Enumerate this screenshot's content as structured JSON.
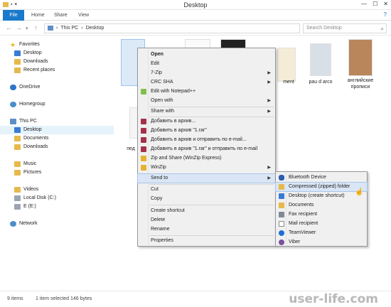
{
  "window": {
    "title": "Desktop",
    "minimize": "—",
    "maximize": "☐",
    "close": "✕"
  },
  "ribbon": {
    "tabs": [
      "File",
      "Home",
      "Share",
      "View"
    ],
    "help": "?"
  },
  "address": {
    "root": "This PC",
    "sep": "›",
    "current": "Desktop",
    "search_placeholder": "Search Desktop"
  },
  "nav": {
    "favorites": "Favorites",
    "fav_items": [
      "Desktop",
      "Downloads",
      "Recent places"
    ],
    "onedrive": "OneDrive",
    "homegroup": "Homegroup",
    "thispc": "This PC",
    "pc_items": [
      "Desktop",
      "Documents",
      "Downloads",
      "Music",
      "Pictures",
      "Videos",
      "Local Disk (C:)",
      "E (E:)"
    ],
    "network": "Network"
  },
  "files": {
    "label_ment": "ment",
    "label_pau": "pau d arco",
    "label_eng_1": "английские",
    "label_eng_2": "прописи",
    "label_ped": "пед"
  },
  "context_menu": {
    "items": [
      "Open",
      "Edit",
      "7-Zip",
      "CRC SHA",
      "Edit with Notepad++",
      "Open with",
      "Share with",
      "Добавить в архив...",
      "Добавить в архив \"1.rar\"",
      "Добавить в архив и отправить по e-mail...",
      "Добавить в архив \"1.rar\" и отправить по e-mail",
      "Zip and Share (WinZip Express)",
      "WinZip",
      "Send to",
      "Cut",
      "Copy",
      "Create shortcut",
      "Delete",
      "Rename",
      "Properties"
    ]
  },
  "sendto_menu": {
    "items": [
      "Bluetooth Device",
      "Compressed (zipped) folder",
      "Desktop (create shortcut)",
      "Documents",
      "Fax recipient",
      "Mail recipient",
      "TeamViewer",
      "Viber"
    ]
  },
  "status": {
    "count": "9 items",
    "selection": "1 item selected  146 bytes"
  },
  "watermark": "user-life.com",
  "colors": {
    "accent": "#1979ca",
    "menu_bg": "#f0f0f0",
    "highlight": "#dae6f5"
  }
}
